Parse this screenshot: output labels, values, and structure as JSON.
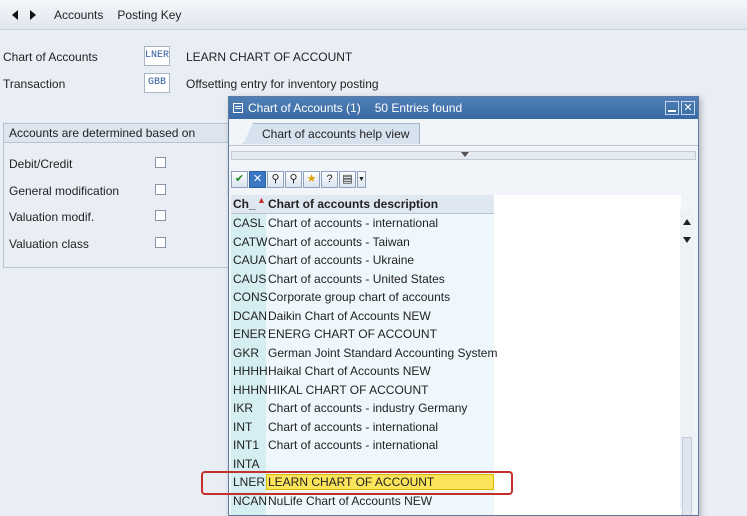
{
  "toolbar": {
    "back_icon": "triangle-left-icon",
    "forward_icon": "triangle-right-icon",
    "items": [
      "Accounts",
      "Posting Key"
    ]
  },
  "form": {
    "chart_of_accounts": {
      "label": "Chart of Accounts",
      "code": "LNER",
      "text": "LEARN CHART OF ACCOUNT"
    },
    "transaction": {
      "label": "Transaction",
      "code": "GBB",
      "text": "Offsetting entry for inventory posting"
    }
  },
  "determination": {
    "title": "Accounts are determined based on",
    "options": [
      {
        "label": "Debit/Credit",
        "checked": false
      },
      {
        "label": "General modification",
        "checked": false
      },
      {
        "label": "Valuation modif.",
        "checked": false
      },
      {
        "label": "Valuation class",
        "checked": false
      }
    ]
  },
  "dialog": {
    "title": "Chart of Accounts (1)",
    "entries_found": "50 Entries found",
    "tab": "Chart of accounts help view",
    "column_code": "Ch_",
    "column_desc": "Chart of accounts description",
    "rows": [
      {
        "code": "CASL",
        "desc": "Chart of accounts - international"
      },
      {
        "code": "CATW",
        "desc": "Chart of accounts - Taiwan"
      },
      {
        "code": "CAUA",
        "desc": "Chart of accounts - Ukraine"
      },
      {
        "code": "CAUS",
        "desc": "Chart of accounts - United States"
      },
      {
        "code": "CONS",
        "desc": "Corporate group chart of accounts"
      },
      {
        "code": "DCAN",
        "desc": "Daikin Chart of Accounts NEW"
      },
      {
        "code": "ENER",
        "desc": "ENERG CHART OF ACCOUNT"
      },
      {
        "code": "GKR",
        "desc": "German Joint Standard Accounting System"
      },
      {
        "code": "HHHH",
        "desc": "Haikal Chart of Accounts NEW"
      },
      {
        "code": "HHHN",
        "desc": "HIKAL CHART OF ACCOUNT"
      },
      {
        "code": "IKR",
        "desc": "Chart of accounts - industry Germany"
      },
      {
        "code": "INT",
        "desc": "Chart of accounts - international"
      },
      {
        "code": "INT1",
        "desc": "Chart of accounts - international"
      },
      {
        "code": "INTA",
        "desc": ""
      },
      {
        "code": "LNER",
        "desc": "LEARN CHART OF ACCOUNT",
        "highlighted": true
      },
      {
        "code": "NCAN",
        "desc": "NuLife Chart of Accounts NEW"
      }
    ]
  },
  "colors": {
    "highlight": "#fbe35a",
    "focus_outline": "#c4302b",
    "title_bar": "#3a6aa3"
  }
}
